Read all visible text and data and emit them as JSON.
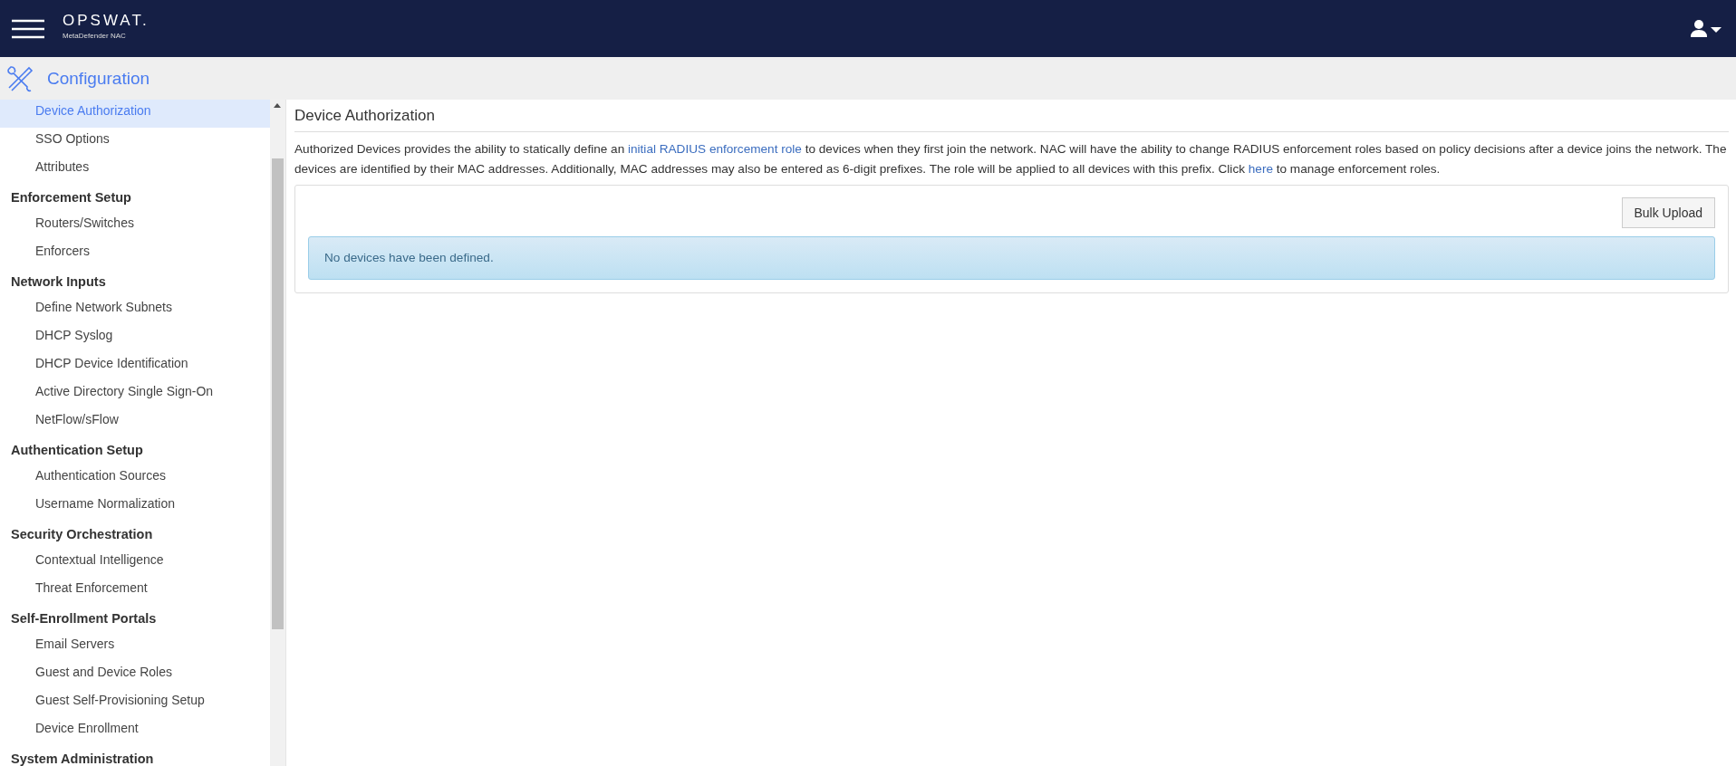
{
  "header": {
    "logo": "OPSWAT.",
    "product": "MetaDefender NAC"
  },
  "section_bar": {
    "title": "Configuration"
  },
  "sidebar": {
    "items": [
      {
        "kind": "item",
        "label": "Device Authorization",
        "selected": true
      },
      {
        "kind": "item",
        "label": "SSO Options",
        "selected": false
      },
      {
        "kind": "item",
        "label": "Attributes",
        "selected": false
      },
      {
        "kind": "heading",
        "label": "Enforcement Setup"
      },
      {
        "kind": "item",
        "label": "Routers/Switches",
        "selected": false
      },
      {
        "kind": "item",
        "label": "Enforcers",
        "selected": false
      },
      {
        "kind": "heading",
        "label": "Network Inputs"
      },
      {
        "kind": "item",
        "label": "Define Network Subnets",
        "selected": false
      },
      {
        "kind": "item",
        "label": "DHCP Syslog",
        "selected": false
      },
      {
        "kind": "item",
        "label": "DHCP Device Identification",
        "selected": false
      },
      {
        "kind": "item",
        "label": "Active Directory Single Sign-On",
        "selected": false
      },
      {
        "kind": "item",
        "label": "NetFlow/sFlow",
        "selected": false
      },
      {
        "kind": "heading",
        "label": "Authentication Setup"
      },
      {
        "kind": "item",
        "label": "Authentication Sources",
        "selected": false
      },
      {
        "kind": "item",
        "label": "Username Normalization",
        "selected": false
      },
      {
        "kind": "heading",
        "label": "Security Orchestration"
      },
      {
        "kind": "item",
        "label": "Contextual Intelligence",
        "selected": false
      },
      {
        "kind": "item",
        "label": "Threat Enforcement",
        "selected": false
      },
      {
        "kind": "heading",
        "label": "Self-Enrollment Portals"
      },
      {
        "kind": "item",
        "label": "Email Servers",
        "selected": false
      },
      {
        "kind": "item",
        "label": "Guest and Device Roles",
        "selected": false
      },
      {
        "kind": "item",
        "label": "Guest Self-Provisioning Setup",
        "selected": false
      },
      {
        "kind": "item",
        "label": "Device Enrollment",
        "selected": false
      },
      {
        "kind": "heading",
        "label": "System Administration"
      }
    ]
  },
  "content": {
    "title": "Device Authorization",
    "description": [
      {
        "kind": "text",
        "text": "Authorized Devices provides the ability to statically define an "
      },
      {
        "kind": "link",
        "text": "initial RADIUS enforcement role"
      },
      {
        "kind": "text",
        "text": " to devices when they first join the network. NAC will have the ability to change RADIUS enforcement roles based on policy decisions after a device joins the network. The devices are identified by their MAC addresses. Additionally, MAC addresses may also be entered as 6-digit prefixes. The role will be applied to all devices with this prefix. Click "
      },
      {
        "kind": "link",
        "text": "here"
      },
      {
        "kind": "text",
        "text": " to manage enforcement roles."
      }
    ],
    "bulk_upload_button": "Bulk Upload",
    "empty_message": "No devices have been defined."
  }
}
